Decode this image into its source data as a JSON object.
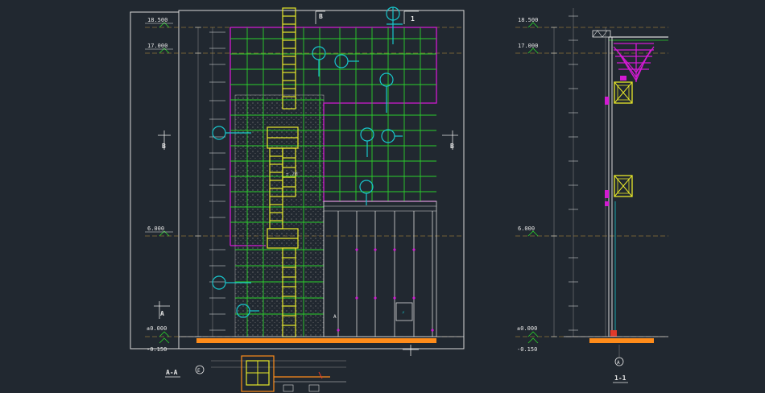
{
  "drawing": {
    "left_elevation": {
      "levels": {
        "top": "18.500",
        "upper": "17.000",
        "mid": "6.000",
        "ground": "±0.000",
        "below": "-0.150"
      },
      "section_markers": {
        "b": "B",
        "a": "A",
        "one": "1"
      },
      "title": "A-A",
      "circle_label": "E",
      "center_text": "±.2M"
    },
    "right_section": {
      "levels": {
        "top": "18.500",
        "upper": "17.000",
        "mid": "6.000",
        "ground": "±0.000",
        "below": "-0.150"
      },
      "axis_label": "A",
      "title": "1-1"
    }
  },
  "colors": {
    "background": "#212830",
    "frame": "#d9d9d9",
    "green_grid": "#2bd12b",
    "magenta": "#d21ad2",
    "yellow": "#e8e82a",
    "cyan": "#18c6cc",
    "orange": "#ff8c1a",
    "red": "#e03a2a",
    "level_line": "#c89a3c"
  }
}
